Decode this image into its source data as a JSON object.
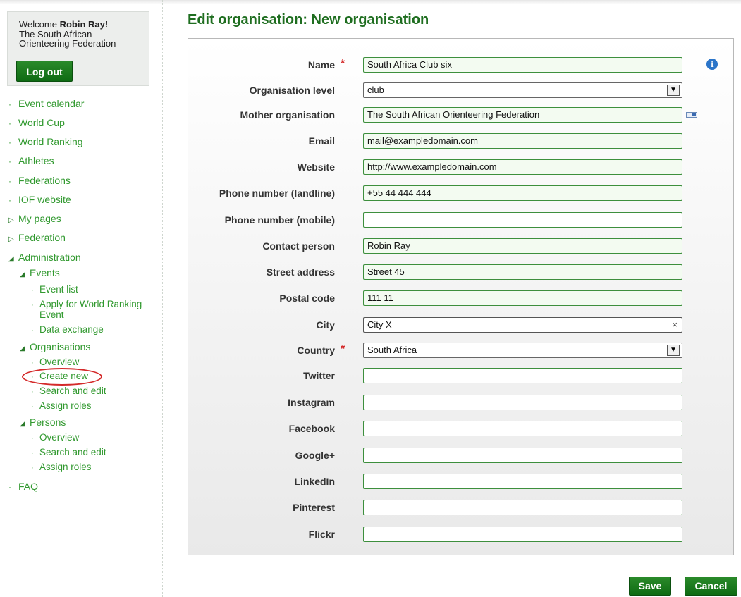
{
  "sidebar": {
    "welcome_prefix": "Welcome",
    "user_name": "Robin Ray!",
    "org_name": "The South African Orienteering Federation",
    "logout_label": "Log out",
    "nav": {
      "event_calendar": "Event calendar",
      "world_cup": "World Cup",
      "world_ranking": "World Ranking",
      "athletes": "Athletes",
      "federations": "Federations",
      "iof_website": "IOF website",
      "my_pages": "My pages",
      "federation": "Federation",
      "administration": "Administration",
      "events": "Events",
      "event_list": "Event list",
      "apply_wre_1": "Apply for World Ranking",
      "apply_wre_2": "Event",
      "data_exchange": "Data exchange",
      "organisations": "Organisations",
      "org_overview": "Overview",
      "create_new": "Create new",
      "org_search_edit": "Search and edit",
      "org_assign_roles": "Assign roles",
      "persons": "Persons",
      "persons_overview": "Overview",
      "persons_search_edit": "Search and edit",
      "persons_assign_roles": "Assign roles",
      "faq": "FAQ"
    }
  },
  "page_title": "Edit organisation: New organisation",
  "form": {
    "name": {
      "label": "Name",
      "value": "South Africa Club six"
    },
    "organisation_level": {
      "label": "Organisation level",
      "value": "club"
    },
    "mother_organisation": {
      "label": "Mother organisation",
      "value": "The South African Orienteering Federation"
    },
    "email": {
      "label": "Email",
      "value": "mail@exampledomain.com"
    },
    "website": {
      "label": "Website",
      "value": "http://www.exampledomain.com"
    },
    "phone_landline": {
      "label": "Phone number (landline)",
      "value": "+55 44 444 444"
    },
    "phone_mobile": {
      "label": "Phone number (mobile)",
      "value": ""
    },
    "contact_person": {
      "label": "Contact person",
      "value": "Robin Ray"
    },
    "street_address": {
      "label": "Street address",
      "value": "Street 45"
    },
    "postal_code": {
      "label": "Postal code",
      "value": "111 11"
    },
    "city": {
      "label": "City",
      "value": "City X"
    },
    "country": {
      "label": "Country",
      "value": "South Africa"
    },
    "twitter": {
      "label": "Twitter",
      "value": ""
    },
    "instagram": {
      "label": "Instagram",
      "value": ""
    },
    "facebook": {
      "label": "Facebook",
      "value": ""
    },
    "googleplus": {
      "label": "Google+",
      "value": ""
    },
    "linkedin": {
      "label": "LinkedIn",
      "value": ""
    },
    "pinterest": {
      "label": "Pinterest",
      "value": ""
    },
    "flickr": {
      "label": "Flickr",
      "value": ""
    }
  },
  "required_marker": "*",
  "buttons": {
    "save": "Save",
    "cancel": "Cancel"
  },
  "colors": {
    "brand_green": "#1f6e20",
    "link_green": "#31992f",
    "required_red": "#d42a2a",
    "highlight_red": "#d42a2a"
  }
}
